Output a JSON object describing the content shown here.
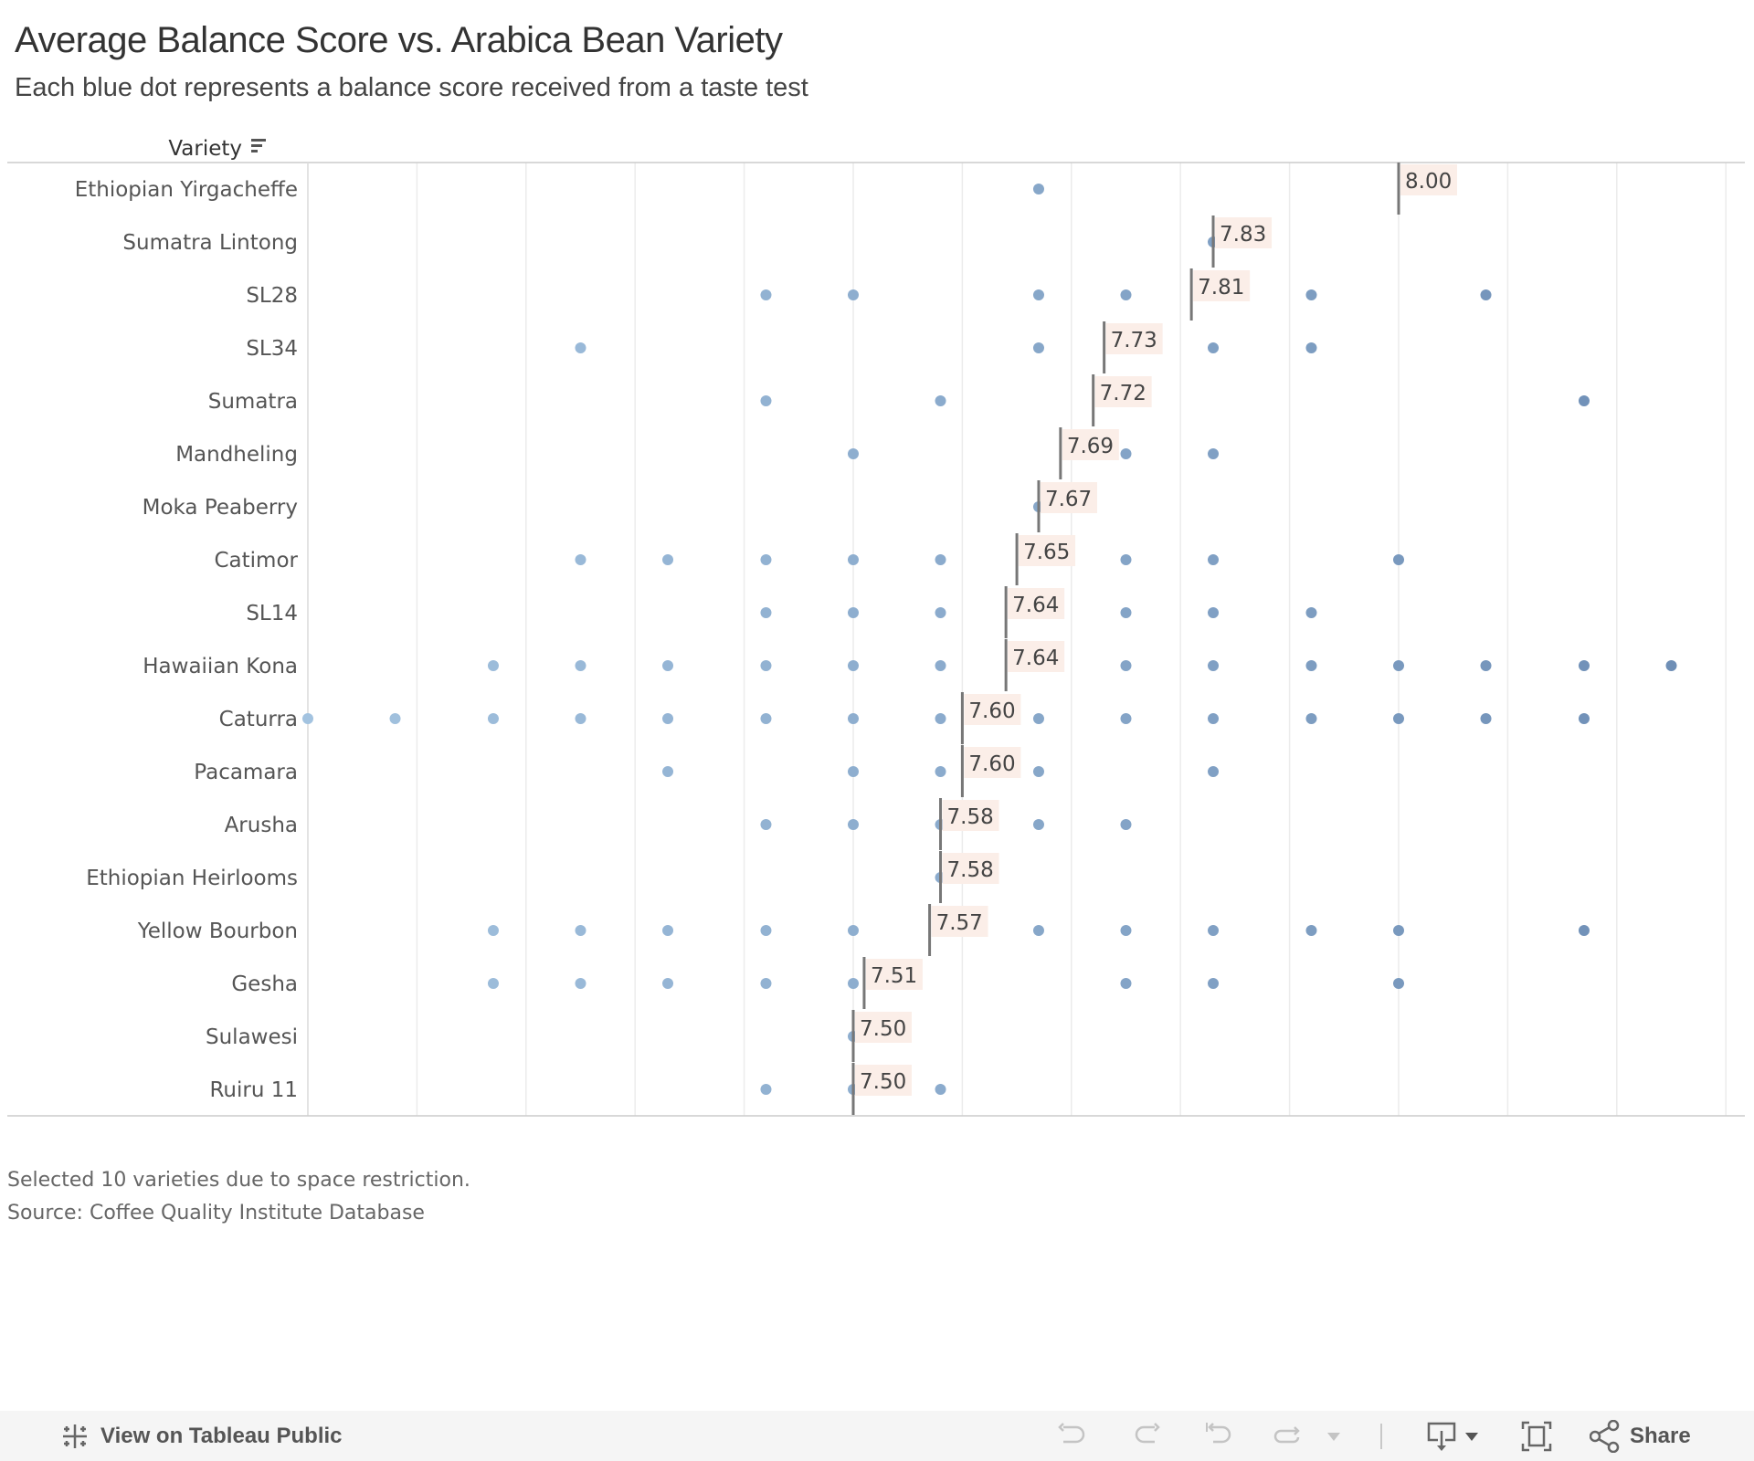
{
  "title": "Average Balance Score vs. Arabica Bean Variety",
  "subtitle": "Each blue dot represents a balance score received from a taste test",
  "notes": [
    "Selected 10 varieties due to space restriction.",
    "Source: Coffee Quality Institute Database"
  ],
  "toolbar": {
    "view_label": "View on Tableau Public",
    "share_label": "Share"
  },
  "chart_data": {
    "type": "scatter",
    "title": "Average Balance Score vs. Arabica Bean Variety",
    "subtitle": "Each blue dot represents a balance score received from a taste test",
    "row_header": "Variety",
    "sort_icon": "sort-descending-icon",
    "xlim": [
      7.0,
      8.3
    ],
    "grid_step": 0.1,
    "grid": true,
    "colors": {
      "dot_light": "#a3c3e0",
      "dot_dark": "#6f8fb6",
      "mean_line": "#777777",
      "label_bg": "#fbeee8"
    },
    "rows": [
      {
        "variety": "Ethiopian Yirgacheffe",
        "mean": 8.0,
        "mean_label": "8.00",
        "scores": [
          7.67
        ]
      },
      {
        "variety": "Sumatra Lintong",
        "mean": 7.83,
        "mean_label": "7.83",
        "scores": [
          7.83
        ]
      },
      {
        "variety": "SL28",
        "mean": 7.81,
        "mean_label": "7.81",
        "scores": [
          7.42,
          7.5,
          7.67,
          7.75,
          7.92,
          8.08
        ]
      },
      {
        "variety": "SL34",
        "mean": 7.73,
        "mean_label": "7.73",
        "scores": [
          7.25,
          7.67,
          7.83,
          7.92
        ]
      },
      {
        "variety": "Sumatra",
        "mean": 7.72,
        "mean_label": "7.72",
        "scores": [
          7.42,
          7.58,
          8.17
        ]
      },
      {
        "variety": "Mandheling",
        "mean": 7.69,
        "mean_label": "7.69",
        "scores": [
          7.5,
          7.75,
          7.83
        ]
      },
      {
        "variety": "Moka Peaberry",
        "mean": 7.67,
        "mean_label": "7.67",
        "scores": [
          7.67
        ]
      },
      {
        "variety": "Catimor",
        "mean": 7.65,
        "mean_label": "7.65",
        "scores": [
          7.25,
          7.33,
          7.42,
          7.5,
          7.58,
          7.75,
          7.83,
          8.0
        ]
      },
      {
        "variety": "SL14",
        "mean": 7.64,
        "mean_label": "7.64",
        "scores": [
          7.42,
          7.5,
          7.58,
          7.75,
          7.83,
          7.92
        ]
      },
      {
        "variety": "Hawaiian Kona",
        "mean": 7.64,
        "mean_label": "7.64",
        "scores": [
          7.17,
          7.25,
          7.33,
          7.42,
          7.5,
          7.58,
          7.75,
          7.83,
          7.92,
          8.0,
          8.08,
          8.17,
          8.25
        ]
      },
      {
        "variety": "Caturra",
        "mean": 7.6,
        "mean_label": "7.60",
        "scores": [
          7.0,
          7.08,
          7.17,
          7.25,
          7.33,
          7.42,
          7.5,
          7.58,
          7.67,
          7.75,
          7.83,
          7.92,
          8.0,
          8.08,
          8.17
        ]
      },
      {
        "variety": "Pacamara",
        "mean": 7.6,
        "mean_label": "7.60",
        "scores": [
          7.33,
          7.5,
          7.58,
          7.67,
          7.83
        ]
      },
      {
        "variety": "Arusha",
        "mean": 7.58,
        "mean_label": "7.58",
        "scores": [
          7.42,
          7.5,
          7.58,
          7.67,
          7.75
        ]
      },
      {
        "variety": "Ethiopian Heirlooms",
        "mean": 7.58,
        "mean_label": "7.58",
        "scores": [
          7.58
        ]
      },
      {
        "variety": "Yellow Bourbon",
        "mean": 7.57,
        "mean_label": "7.57",
        "scores": [
          7.17,
          7.25,
          7.33,
          7.42,
          7.5,
          7.67,
          7.75,
          7.83,
          7.92,
          8.0,
          8.17
        ]
      },
      {
        "variety": "Gesha",
        "mean": 7.51,
        "mean_label": "7.51",
        "scores": [
          7.17,
          7.25,
          7.33,
          7.42,
          7.5,
          7.75,
          7.83,
          8.0
        ]
      },
      {
        "variety": "Sulawesi",
        "mean": 7.5,
        "mean_label": "7.50",
        "scores": [
          7.5
        ]
      },
      {
        "variety": "Ruiru 11",
        "mean": 7.5,
        "mean_label": "7.50",
        "scores": [
          7.42,
          7.5,
          7.58
        ]
      }
    ]
  }
}
